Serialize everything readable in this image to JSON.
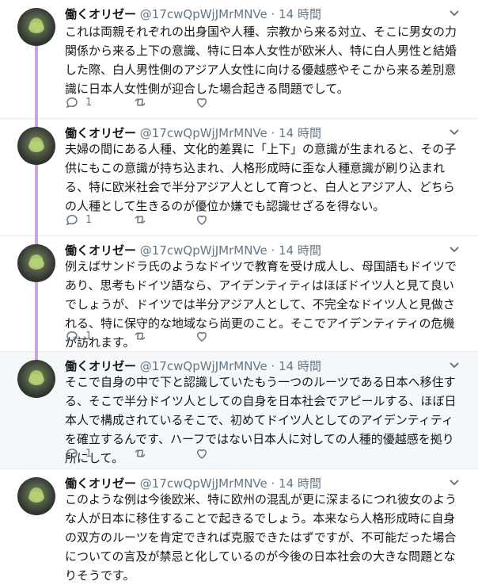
{
  "tweets": [
    {
      "name": "働くオリゼー",
      "handle": "@17cwQpWjJMrMNVe",
      "dot": "·",
      "time": "14 時間",
      "text": "これは両親それぞれの出身国や人種、宗教から来る対立、そこに男女の力関係から来る上下の意識、特に日本人女性が欧米人、特に白人男性と結婚した際、白人男性側のアジア人女性に向ける優越感やそこから来る差別意識に日本人女性側が迎合した場合起きる問題でして。",
      "reply_count": "1"
    },
    {
      "name": "働くオリゼー",
      "handle": "@17cwQpWjJMrMNVe",
      "dot": "·",
      "time": "14 時間",
      "text": "夫婦の間にある人種、文化的差異に「上下」の意識が生まれると、その子供にもこの意識が持ち込まれ、人格形成時に歪な人種意識が刷り込まれる、特に欧米社会で半分アジア人として育つと、白人とアジア人、どちらの人種として生きるのが優位か嫌でも認識せざるを得ない。",
      "reply_count": "1"
    },
    {
      "name": "働くオリゼー",
      "handle": "@17cwQpWjJMrMNVe",
      "dot": "·",
      "time": "14 時間",
      "text": "例えばサンドラ氏のようなドイツで教育を受け成人し、母国語もドイツであり、思考もドイツ語なら、アイデンティティはほぼドイツ人と見て良いでしょうが、ドイツでは半分アジア人として、不完全なドイツ人と見做される、特に保守的な地域なら尚更のこと。そこでアイデンティティの危機が訪れます。",
      "reply_count": "1"
    },
    {
      "name": "働くオリゼー",
      "handle": "@17cwQpWjJMrMNVe",
      "dot": "·",
      "time": "14 時間",
      "text": "そこで自身の中で下と認識していたもう一つのルーツである日本へ移住する、そこで半分ドイツ人としての自身を日本社会でアピールする、ほぼ日本人で構成されているそこで、初めてドイツ人としてのアイデンティティを確立するんです、ハーフではない日本人に対しての人種的優越感を拠り所にして。",
      "reply_count": "1"
    },
    {
      "name": "働くオリゼー",
      "handle": "@17cwQpWjJMrMNVe",
      "dot": "·",
      "time": "14 時間",
      "text": "このような例は今後欧米、特に欧州の混乱が更に深まるにつれ彼女のような人が日本に移住することで起きるでしょう。本来なら人格形成時に自身の双方のルーツを肯定できれば克服できたはずですが、不可能だった場合についての言及が禁忌と化しているのが今後の日本社会の大きな問題となりそうです。",
      "reply_count": ""
    }
  ],
  "colors": {
    "thread_line": "#c8a6e6",
    "secondary_text": "#657786",
    "highlight_bg": "#f5f8fa"
  },
  "icons": [
    "avatar",
    "chevron-down-icon",
    "reply-icon",
    "retweet-icon",
    "like-icon"
  ]
}
